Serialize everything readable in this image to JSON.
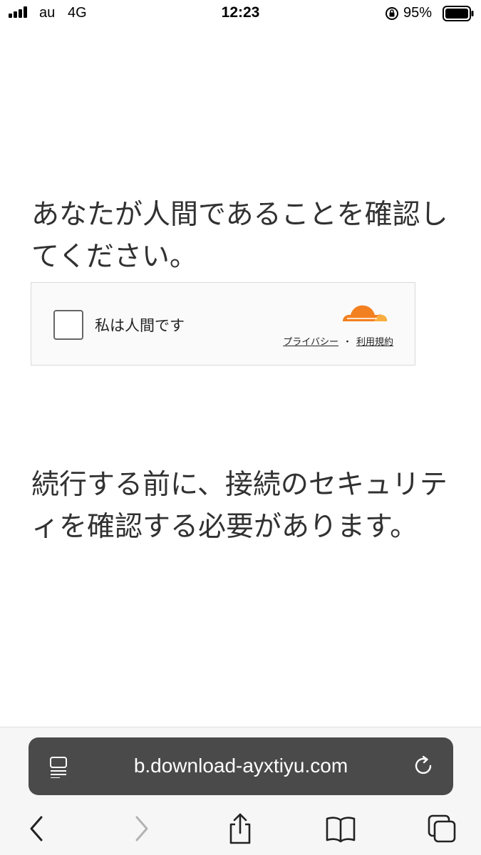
{
  "status_bar": {
    "carrier": "au",
    "network": "4G",
    "time": "12:23",
    "battery_percent": "95%",
    "icons": [
      "signal-icon",
      "rotation-lock-icon",
      "battery-icon"
    ]
  },
  "main": {
    "heading": "あなたが人間であることを確認してください。",
    "widget": {
      "checkbox_label": "私は人間です",
      "privacy_link": "プライバシー",
      "separator": "・",
      "terms_link": "利用規約",
      "logo": "cloudflare-logo",
      "logo_color": "#f38020"
    },
    "message": "続行する前に、接続のセキュリティを確認する必要があります。"
  },
  "browser": {
    "url": "b.download-ayxtiyu.com",
    "toolbar_icons": [
      "back-icon",
      "forward-icon",
      "share-icon",
      "bookmarks-icon",
      "tabs-icon"
    ]
  },
  "colors": {
    "text": "#313131",
    "address_bar": "#4a4a4a",
    "ios_blue_disabled": "#b3b3b3"
  }
}
